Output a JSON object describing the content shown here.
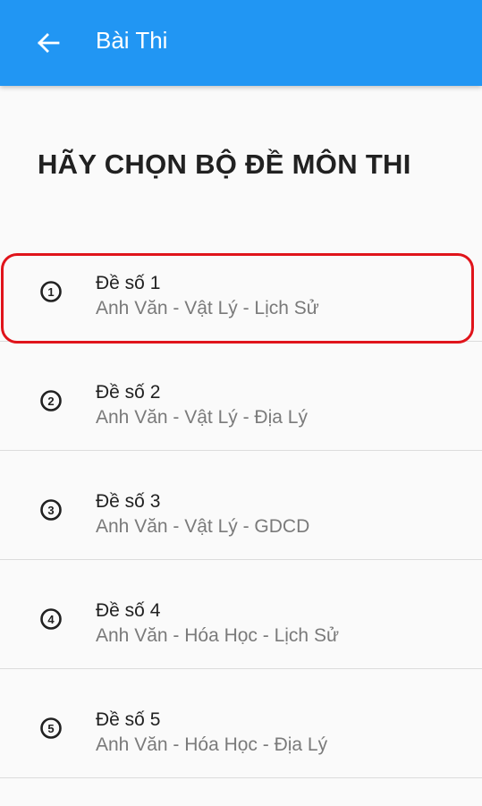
{
  "appbar": {
    "title": "Bài Thi",
    "back_icon": "arrow-left-icon",
    "color": "#2196f3"
  },
  "heading": "HÃY CHỌN BỘ ĐỀ MÔN THI",
  "exams": [
    {
      "icon_number": "1",
      "title": "Đề số 1",
      "subjects": "Anh Văn - Vật Lý - Lịch Sử",
      "highlighted": true
    },
    {
      "icon_number": "2",
      "title": "Đề số 2",
      "subjects": "Anh Văn - Vật Lý - Địa Lý",
      "highlighted": false
    },
    {
      "icon_number": "3",
      "title": "Đề số 3",
      "subjects": "Anh Văn - Vật Lý - GDCD",
      "highlighted": false
    },
    {
      "icon_number": "4",
      "title": "Đề số 4",
      "subjects": "Anh Văn - Hóa Học - Lịch Sử",
      "highlighted": false
    },
    {
      "icon_number": "5",
      "title": "Đề số 5",
      "subjects": "Anh Văn - Hóa Học - Địa Lý",
      "highlighted": false
    }
  ],
  "highlight_color": "#e0141b"
}
